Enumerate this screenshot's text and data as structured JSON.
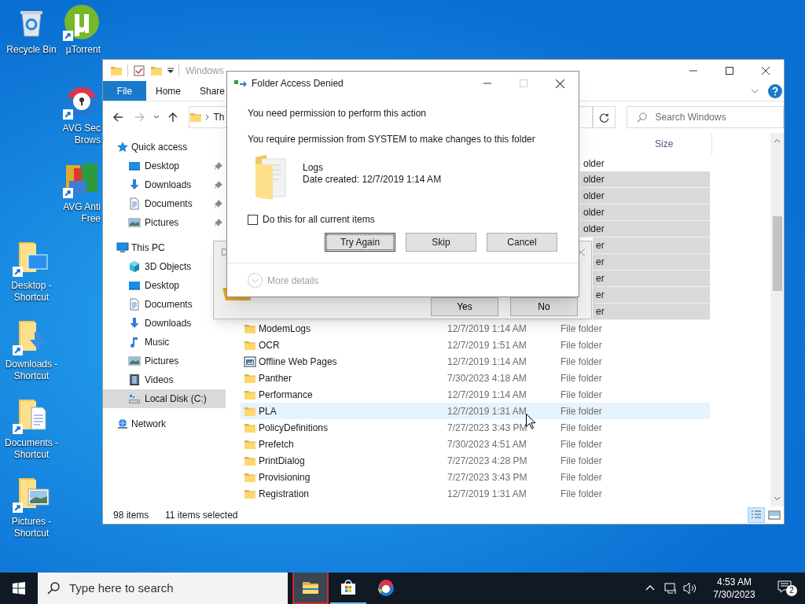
{
  "desktop_icons": [
    {
      "lines": [
        "Recycle Bin"
      ],
      "kind": "recycle",
      "shortcut": false
    },
    {
      "lines": [
        "µTorrent"
      ],
      "kind": "torrent",
      "shortcut": true
    },
    {
      "lines": [
        "AVG Sec",
        "Brows"
      ],
      "kind": "browser",
      "shortcut": true
    },
    {
      "lines": [
        "AVG Anti",
        "Free"
      ],
      "kind": "antivirus",
      "shortcut": true
    },
    {
      "lines": [
        "Desktop -",
        "Shortcut"
      ],
      "kind": "desktop",
      "shortcut": true
    },
    {
      "lines": [
        "Downloads -",
        "Shortcut"
      ],
      "kind": "downloads",
      "shortcut": true
    },
    {
      "lines": [
        "Documents -",
        "Shortcut"
      ],
      "kind": "documents",
      "shortcut": true
    },
    {
      "lines": [
        "Pictures -",
        "Shortcut"
      ],
      "kind": "pictures",
      "shortcut": true
    }
  ],
  "explorer": {
    "title": "Windows",
    "ribbon_tabs": [
      {
        "label": "File",
        "kind": "file"
      },
      {
        "label": "Home",
        "kind": "tab"
      },
      {
        "label": "Share",
        "kind": "tab"
      }
    ],
    "address": "Th",
    "search": {
      "placeholder": "Search Windows"
    },
    "column_headers": [
      "Size"
    ],
    "nav": [
      {
        "label": "Quick access",
        "kind": "star",
        "selected": false,
        "children": [
          {
            "label": "Desktop",
            "kind": "desktop",
            "pinned": true,
            "selected": false
          },
          {
            "label": "Downloads",
            "kind": "downloads",
            "pinned": true,
            "selected": false
          },
          {
            "label": "Documents",
            "kind": "documents",
            "pinned": true,
            "selected": false
          },
          {
            "label": "Pictures",
            "kind": "pictures",
            "pinned": true,
            "selected": false
          }
        ]
      },
      {
        "label": "This PC",
        "kind": "pc",
        "selected": false,
        "children": [
          {
            "label": "3D Objects",
            "kind": "cube",
            "pinned": false,
            "selected": false
          },
          {
            "label": "Desktop",
            "kind": "desktop",
            "pinned": false,
            "selected": false
          },
          {
            "label": "Documents",
            "kind": "documents",
            "pinned": false,
            "selected": false
          },
          {
            "label": "Downloads",
            "kind": "downloads",
            "pinned": false,
            "selected": false
          },
          {
            "label": "Music",
            "kind": "music",
            "pinned": false,
            "selected": false
          },
          {
            "label": "Pictures",
            "kind": "pictures",
            "pinned": false,
            "selected": false
          },
          {
            "label": "Videos",
            "kind": "videos",
            "pinned": false,
            "selected": false
          },
          {
            "label": "Local Disk (C:)",
            "kind": "drive",
            "pinned": false,
            "selected": true
          }
        ]
      },
      {
        "label": "Network",
        "kind": "network",
        "selected": false
      }
    ],
    "rows": [
      {
        "kind": "covered_front",
        "type": "older",
        "selected": false,
        "hovered": false
      },
      {
        "kind": "covered_front",
        "type": "older",
        "selected": true,
        "hovered": false
      },
      {
        "kind": "covered_front",
        "type": "older",
        "selected": true,
        "hovered": false
      },
      {
        "kind": "covered_front",
        "type": "older",
        "selected": true,
        "hovered": false
      },
      {
        "kind": "covered_front",
        "type": "older",
        "selected": true,
        "hovered": false
      },
      {
        "kind": "covered_back",
        "type": "er",
        "selected": true,
        "hovered": false
      },
      {
        "kind": "covered_back",
        "type": "er",
        "selected": true,
        "hovered": false
      },
      {
        "kind": "covered_back",
        "type": "er",
        "selected": true,
        "hovered": false
      },
      {
        "kind": "covered_back",
        "type": "er",
        "selected": true,
        "hovered": false
      },
      {
        "kind": "covered_back",
        "type": "er",
        "selected": true,
        "hovered": false
      },
      {
        "kind": "folder",
        "name": "ModemLogs",
        "date": "12/7/2019 1:14 AM",
        "type": "File folder",
        "selected": false,
        "hovered": false
      },
      {
        "kind": "folder",
        "name": "OCR",
        "date": "12/7/2019 1:51 AM",
        "type": "File folder",
        "selected": false,
        "hovered": false
      },
      {
        "kind": "web",
        "name": "Offline Web Pages",
        "date": "12/7/2019 1:14 AM",
        "type": "File folder",
        "selected": false,
        "hovered": false
      },
      {
        "kind": "folder",
        "name": "Panther",
        "date": "7/30/2023 4:18 AM",
        "type": "File folder",
        "selected": false,
        "hovered": false
      },
      {
        "kind": "folder",
        "name": "Performance",
        "date": "12/7/2019 1:14 AM",
        "type": "File folder",
        "selected": false,
        "hovered": false
      },
      {
        "kind": "folder",
        "name": "PLA",
        "date": "12/7/2019 1:31 AM",
        "type": "File folder",
        "selected": false,
        "hovered": true
      },
      {
        "kind": "folder",
        "name": "PolicyDefinitions",
        "date": "7/27/2023 3:43 PM",
        "type": "File folder",
        "selected": false,
        "hovered": false
      },
      {
        "kind": "folder",
        "name": "Prefetch",
        "date": "7/30/2023 4:51 AM",
        "type": "File folder",
        "selected": false,
        "hovered": false
      },
      {
        "kind": "folder",
        "name": "PrintDialog",
        "date": "7/27/2023 4:28 PM",
        "type": "File folder",
        "selected": false,
        "hovered": false
      },
      {
        "kind": "folder",
        "name": "Provisioning",
        "date": "7/27/2023 3:43 PM",
        "type": "File folder",
        "selected": false,
        "hovered": false
      },
      {
        "kind": "folder",
        "name": "Registration",
        "date": "12/7/2019 1:31 AM",
        "type": "File folder",
        "selected": false,
        "hovered": false
      }
    ],
    "status_bar": {
      "count": "98 items",
      "selection": "11 items selected"
    },
    "views": [
      {
        "kind": "details",
        "selected": true
      },
      {
        "kind": "thumbnails",
        "selected": false
      }
    ]
  },
  "back_dialog": {
    "title": "D",
    "buttons": [
      "Yes",
      "No"
    ]
  },
  "dialog": {
    "title": "Folder Access Denied",
    "heading": "You need permission to perform this action",
    "message": "You require permission from SYSTEM to make changes to this folder",
    "item_name": "Logs",
    "item_date": "Date created: 12/7/2019 1:14 AM",
    "checkbox": {
      "label": "Do this for all current items",
      "checked": false
    },
    "buttons": [
      {
        "label": "Try Again",
        "focused": true
      },
      {
        "label": "Skip",
        "focused": false
      },
      {
        "label": "Cancel",
        "focused": false
      }
    ],
    "details": {
      "label": "More details",
      "disabled": true
    }
  },
  "taskbar": {
    "search": {
      "placeholder": "Type here to search"
    },
    "apps": [
      {
        "kind": "explorer",
        "active": true,
        "running": true
      },
      {
        "kind": "store",
        "active": false,
        "running": true
      },
      {
        "kind": "browser",
        "active": false,
        "running": false
      }
    ],
    "time": "4:53 AM",
    "date": "7/30/2023",
    "notifications": "2"
  }
}
